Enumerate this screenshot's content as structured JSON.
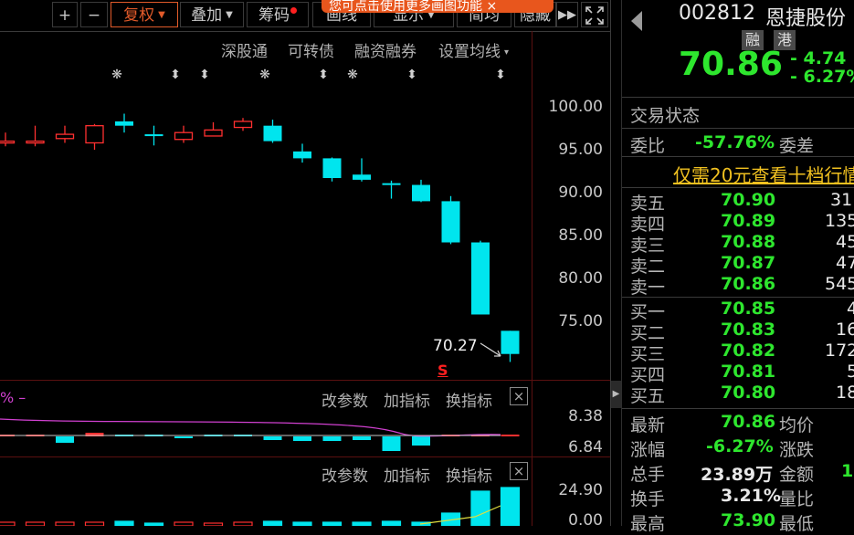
{
  "toolbar": {
    "zoom_in": "+",
    "zoom_out": "−",
    "fuquan": "复权",
    "diejia": "叠加",
    "chouma": "筹码",
    "huaxian": "画线",
    "xianshi": "显示",
    "jianjun": "简均",
    "yincang": "隐藏",
    "tooltip": "您可点击使用更多画图功能 ×"
  },
  "chart_links": {
    "shengutong": "深股通",
    "kezhuanzhai": "可转债",
    "rongzirongquan": "融资融券",
    "set_ma": "设置均线"
  },
  "chart_data": {
    "type": "candlestick",
    "y_ticks": [
      "100.00",
      "95.00",
      "90.00",
      "85.00",
      "80.00",
      "75.00"
    ],
    "ylim": [
      70,
      102
    ],
    "candles": [
      {
        "o": 96.0,
        "c": 96.0,
        "h": 97.0,
        "l": 95.4,
        "up": true
      },
      {
        "o": 96.0,
        "c": 96.0,
        "h": 97.8,
        "l": 95.4,
        "up": true
      },
      {
        "o": 96.3,
        "c": 96.8,
        "h": 97.8,
        "l": 95.8,
        "up": true
      },
      {
        "o": 95.8,
        "c": 97.8,
        "h": 98.0,
        "l": 95.0,
        "up": true
      },
      {
        "o": 98.3,
        "c": 97.8,
        "h": 99.2,
        "l": 97.0,
        "up": false
      },
      {
        "o": 96.8,
        "c": 96.8,
        "h": 97.8,
        "l": 95.5,
        "up": false
      },
      {
        "o": 96.2,
        "c": 97.0,
        "h": 97.8,
        "l": 95.8,
        "up": true
      },
      {
        "o": 96.6,
        "c": 97.3,
        "h": 98.2,
        "l": 96.6,
        "up": true
      },
      {
        "o": 97.6,
        "c": 98.3,
        "h": 98.7,
        "l": 97.2,
        "up": true
      },
      {
        "o": 97.8,
        "c": 96.0,
        "h": 98.5,
        "l": 95.8,
        "up": false
      },
      {
        "o": 94.8,
        "c": 94.0,
        "h": 95.7,
        "l": 93.5,
        "up": false
      },
      {
        "o": 94.0,
        "c": 91.7,
        "h": 94.1,
        "l": 91.3,
        "up": false
      },
      {
        "o": 92.1,
        "c": 91.5,
        "h": 94.0,
        "l": 91.3,
        "up": false
      },
      {
        "o": 91.1,
        "c": 91.0,
        "h": 91.4,
        "l": 89.3,
        "up": false
      },
      {
        "o": 90.9,
        "c": 89.0,
        "h": 91.5,
        "l": 88.9,
        "up": false
      },
      {
        "o": 89.0,
        "c": 84.2,
        "h": 89.6,
        "l": 84.0,
        "up": false
      },
      {
        "o": 84.2,
        "c": 75.8,
        "h": 84.4,
        "l": 75.8,
        "up": false
      },
      {
        "o": 73.9,
        "c": 71.2,
        "h": 73.9,
        "l": 70.27,
        "up": false
      }
    ],
    "event_markers": [
      "❋",
      "⬍",
      "⬍",
      "❋",
      "⬍",
      "❋",
      "⬍",
      "⬍"
    ],
    "low_annotation": "70.27",
    "signal_marker": "S",
    "indicator_panel": {
      "y_ticks": [
        "8.38",
        "6.84"
      ],
      "label": "%"
    },
    "volume_panel": {
      "y_ticks": [
        "24.90",
        "0.00"
      ]
    }
  },
  "sub_panel": {
    "gaicanshu": "改参数",
    "jiazhibiao": "加指标",
    "huanzhibiao": "换指标",
    "close": "×"
  },
  "quote": {
    "code": "002812",
    "name": "恩捷股份",
    "tag_rong": "融",
    "tag_gang": "港",
    "price": "70.86",
    "change": "- 4.74",
    "change_pct": "- 6.27%",
    "trade_status": "交易状态",
    "weibi_label": "委比",
    "weibi_value": "-57.76%",
    "weicha_label": "委差",
    "promo": "仅需20元查看十档行情",
    "asks": [
      {
        "label": "卖五",
        "price": "70.90",
        "vol": "31"
      },
      {
        "label": "卖四",
        "price": "70.89",
        "vol": "135"
      },
      {
        "label": "卖三",
        "price": "70.88",
        "vol": "45"
      },
      {
        "label": "卖二",
        "price": "70.87",
        "vol": "47"
      },
      {
        "label": "卖一",
        "price": "70.86",
        "vol": "545"
      }
    ],
    "bids": [
      {
        "label": "买一",
        "price": "70.85",
        "vol": "4"
      },
      {
        "label": "买二",
        "price": "70.83",
        "vol": "16"
      },
      {
        "label": "买三",
        "price": "70.82",
        "vol": "172"
      },
      {
        "label": "买四",
        "price": "70.81",
        "vol": "5"
      },
      {
        "label": "买五",
        "price": "70.80",
        "vol": "18"
      }
    ],
    "stats": [
      {
        "label": "最新",
        "value": "70.86",
        "label2": "均价"
      },
      {
        "label": "涨幅",
        "value": "-6.27%",
        "label2": "涨跌"
      },
      {
        "label": "总手",
        "value": "23.89万",
        "label2": "金额",
        "value2": "1"
      },
      {
        "label": "换手",
        "value": "3.21%",
        "label2": "量比"
      },
      {
        "label": "最高",
        "value": "73.90",
        "label2": "最低"
      }
    ],
    "colors": {
      "up": "#ff3030",
      "down": "#00e5ee",
      "green_text": "#2ee62e"
    }
  }
}
